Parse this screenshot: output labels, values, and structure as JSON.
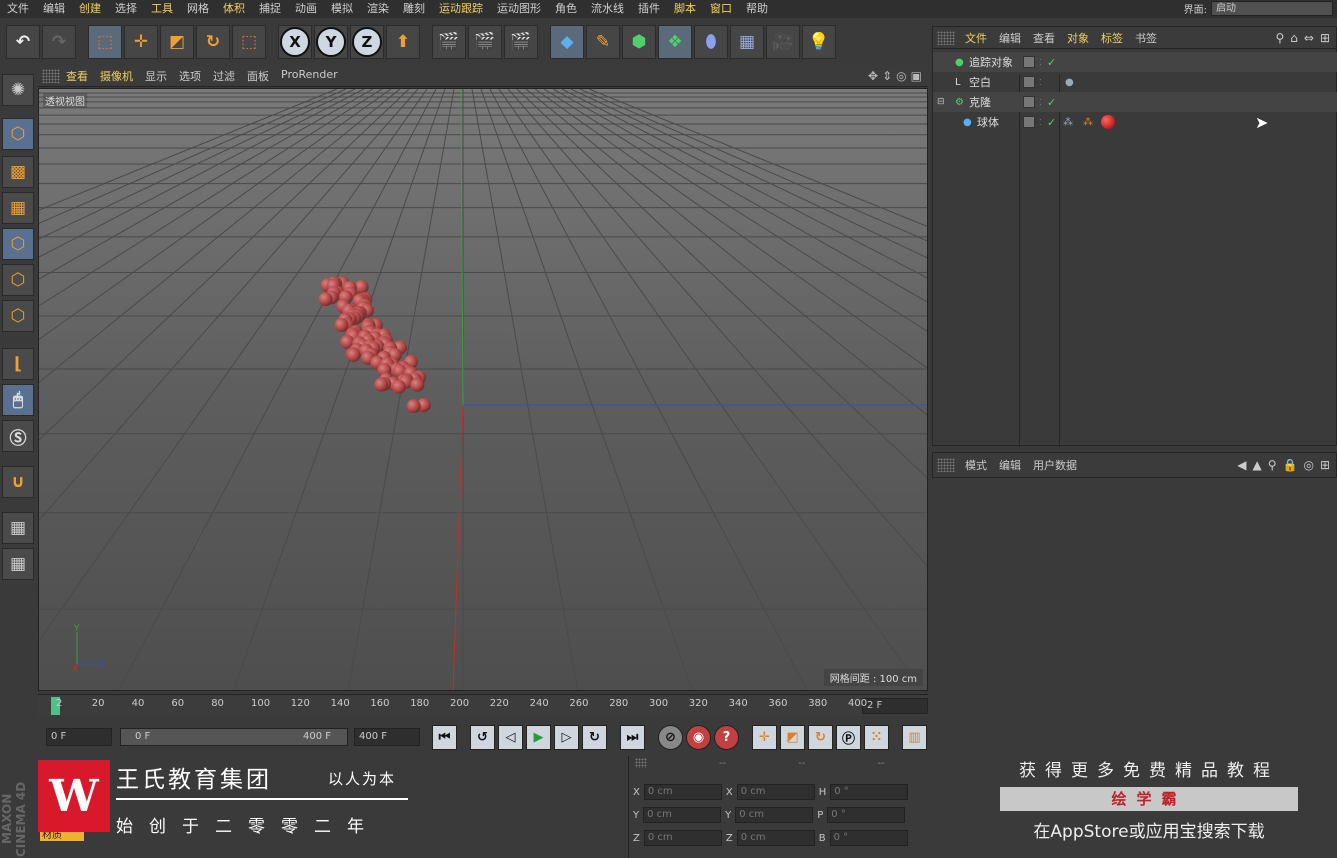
{
  "menu": [
    "文件",
    "编辑",
    "创建",
    "选择",
    "工具",
    "网格",
    "体积",
    "捕捉",
    "动画",
    "模拟",
    "渲染",
    "雕刻",
    "运动跟踪",
    "运动图形",
    "角色",
    "流水线",
    "插件",
    "脚本",
    "窗口",
    "帮助"
  ],
  "menu_highlight": [
    "创建",
    "工具",
    "体积",
    "运动跟踪",
    "脚本",
    "窗口"
  ],
  "layout": {
    "label": "界面:",
    "value": "启动"
  },
  "toolbar_axis": [
    "X",
    "Y",
    "Z"
  ],
  "viewport": {
    "tabs": [
      "查看",
      "摄像机",
      "显示",
      "选项",
      "过滤",
      "面板",
      "ProRender"
    ],
    "highlight_tabs": [
      "查看",
      "摄像机"
    ],
    "label": "透视视图",
    "grid_distance": "网格间距 : 100 cm",
    "axis_x": "X",
    "axis_y": "Y",
    "axis_z": "Z"
  },
  "timeline": {
    "ticks": [
      "2",
      "20",
      "40",
      "60",
      "80",
      "100",
      "120",
      "140",
      "160",
      "180",
      "200",
      "220",
      "240",
      "260",
      "280",
      "300",
      "320",
      "340",
      "360",
      "380",
      "400"
    ],
    "current_frame": "2 F"
  },
  "playbar": {
    "start": "0 F",
    "range_start": "0 F",
    "range_end": "400 F",
    "end": "400 F"
  },
  "object_manager": {
    "tabs": [
      "文件",
      "编辑",
      "查看",
      "对象",
      "标签",
      "书签"
    ],
    "highlight_tabs": [
      "文件",
      "对象",
      "标签"
    ],
    "objects": [
      {
        "name": "追踪对象"
      },
      {
        "name": "空白"
      },
      {
        "name": "克隆"
      },
      {
        "name": "球体"
      }
    ]
  },
  "attributes": {
    "tabs": [
      "模式",
      "编辑",
      "用户数据"
    ]
  },
  "coords": {
    "header": [
      "--",
      "--",
      "--"
    ],
    "rows": [
      {
        "a": "X",
        "av": "0 cm",
        "b": "X",
        "bv": "0 cm",
        "c": "H",
        "cv": "0 °"
      },
      {
        "a": "Y",
        "av": "0 cm",
        "b": "Y",
        "bv": "0 cm",
        "c": "P",
        "cv": "0 °"
      },
      {
        "a": "Z",
        "av": "0 cm",
        "b": "Z",
        "bv": "0 cm",
        "c": "B",
        "cv": "0 °"
      }
    ]
  },
  "material_tag": "材质",
  "logo": {
    "mark": "W",
    "name": "王氏教育集团",
    "slogan": "以人为本",
    "founded": "始创于二零零二年"
  },
  "promo": {
    "line1": "获得更多免费精品教程",
    "brand": "绘学霸",
    "line3": "在AppStore或应用宝搜索下载"
  },
  "watermark": "MAXON CINEMA 4D"
}
